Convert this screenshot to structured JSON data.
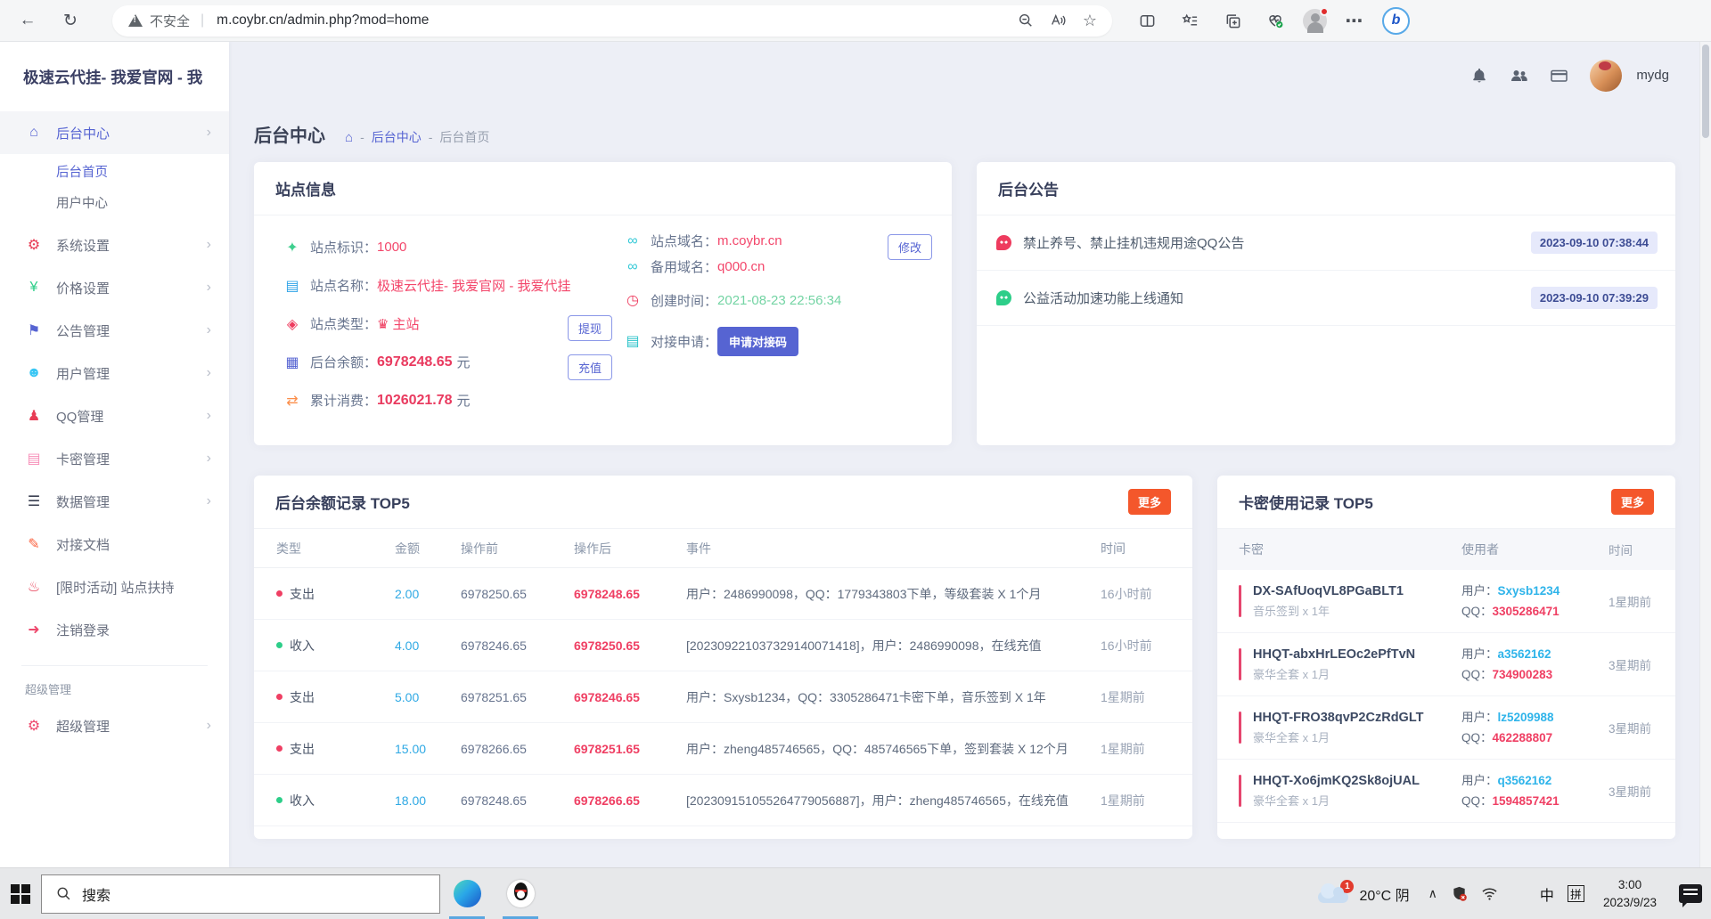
{
  "browser": {
    "security_label": "不安全",
    "url": "m.coybr.cn/admin.php?mod=home"
  },
  "header": {
    "username": "mydg"
  },
  "sidebar": {
    "logo": "极速云代挂- 我爱官网 - 我",
    "section_label": "超级管理",
    "items": [
      {
        "label": "后台中心",
        "icon": "home-icon"
      },
      {
        "label": "后台首页"
      },
      {
        "label": "用户中心"
      },
      {
        "label": "系统设置",
        "icon": "gear-icon"
      },
      {
        "label": "价格设置",
        "icon": "cart-icon"
      },
      {
        "label": "公告管理",
        "icon": "megaphone-icon"
      },
      {
        "label": "用户管理",
        "icon": "users-icon"
      },
      {
        "label": "QQ管理",
        "icon": "qq-icon"
      },
      {
        "label": "卡密管理",
        "icon": "card-icon"
      },
      {
        "label": "数据管理",
        "icon": "list-icon"
      },
      {
        "label": "对接文档",
        "icon": "doc-icon"
      },
      {
        "label": "[限时活动] 站点扶持",
        "icon": "cake-icon"
      },
      {
        "label": "注销登录",
        "icon": "logout-icon"
      },
      {
        "label": "超级管理",
        "icon": "gears-icon"
      }
    ]
  },
  "breadcrumb": {
    "title": "后台中心",
    "sep": "-",
    "home": "后台中心",
    "current": "后台首页"
  },
  "site_info": {
    "title": "站点信息",
    "fields": [
      {
        "label": "站点标识：",
        "value": "1000"
      },
      {
        "label": "站点名称：",
        "value": "极速云代挂- 我爱官网 - 我爱代挂"
      },
      {
        "label": "站点类型：",
        "value": "主站"
      },
      {
        "label": "后台余额：",
        "value": "6978248.65",
        "unit": "元"
      },
      {
        "label": "累计消费：",
        "value": "1026021.78",
        "unit": "元"
      }
    ],
    "fields_right": [
      {
        "label": "站点域名：",
        "value": "m.coybr.cn"
      },
      {
        "label": "备用域名：",
        "value": "q000.cn"
      },
      {
        "label": "创建时间：",
        "value": "2021-08-23 22:56:34"
      },
      {
        "label": "对接申请："
      }
    ],
    "buttons": {
      "withdraw": "提现",
      "recharge": "充值",
      "modify": "修改",
      "apply": "申请对接码"
    }
  },
  "announcements": {
    "title": "后台公告",
    "items": [
      {
        "text": "禁止养号、禁止挂机违规用途QQ公告",
        "time": "2023-09-10 07:38:44"
      },
      {
        "text": "公益活动加速功能上线通知",
        "time": "2023-09-10 07:39:29"
      }
    ]
  },
  "balance": {
    "title": "后台余额记录 TOP5",
    "more": "更多",
    "headers": [
      "类型",
      "金额",
      "操作前",
      "操作后",
      "事件",
      "时间"
    ],
    "rows": [
      {
        "type": "支出",
        "amount": "2.00",
        "before": "6978250.65",
        "after": "6978248.65",
        "event": "用户：2486990098，QQ：1779343803下单，等级套装 X 1个月",
        "time": "16小时前"
      },
      {
        "type": "收入",
        "amount": "4.00",
        "before": "6978246.65",
        "after": "6978250.65",
        "event": "[202309221037329140071418]，用户：2486990098，在线充值",
        "time": "16小时前"
      },
      {
        "type": "支出",
        "amount": "5.00",
        "before": "6978251.65",
        "after": "6978246.65",
        "event": "用户：Sxysb1234，QQ：3305286471卡密下单，音乐签到 X 1年",
        "time": "1星期前"
      },
      {
        "type": "支出",
        "amount": "15.00",
        "before": "6978266.65",
        "after": "6978251.65",
        "event": "用户：zheng485746565，QQ：485746565下单，签到套装 X 12个月",
        "time": "1星期前"
      },
      {
        "type": "收入",
        "amount": "18.00",
        "before": "6978248.65",
        "after": "6978266.65",
        "event": "[202309151055264779056887]，用户：zheng485746565，在线充值",
        "time": "1星期前"
      }
    ]
  },
  "keys": {
    "title": "卡密使用记录 TOP5",
    "more": "更多",
    "headers": [
      "卡密",
      "使用者",
      "时间"
    ],
    "user_label": "用户：",
    "qq_label": "QQ：",
    "rows": [
      {
        "key": "DX-SAfUoqVL8PGaBLT1",
        "plan": "音乐签到 x 1年",
        "user": "Sxysb1234",
        "qq": "3305286471",
        "time": "1星期前"
      },
      {
        "key": "HHQT-abxHrLEOc2ePfTvN",
        "plan": "豪华全套 x 1月",
        "user": "a3562162",
        "qq": "734900283",
        "time": "3星期前"
      },
      {
        "key": "HHQT-FRO38qvP2CzRdGLT",
        "plan": "豪华全套 x 1月",
        "user": "lz5209988",
        "qq": "462288807",
        "time": "3星期前"
      },
      {
        "key": "HHQT-Xo6jmKQ2Sk8ojUAL",
        "plan": "豪华全套 x 1月",
        "user": "q3562162",
        "qq": "1594857421",
        "time": "3星期前"
      }
    ]
  },
  "taskbar": {
    "search_placeholder": "搜索",
    "weather_temp": "20°C",
    "weather_cond": "阴",
    "weather_badge": "1",
    "ime_lang": "中",
    "ime_mode": "拼",
    "time": "3:00",
    "date": "2023/9/23"
  }
}
